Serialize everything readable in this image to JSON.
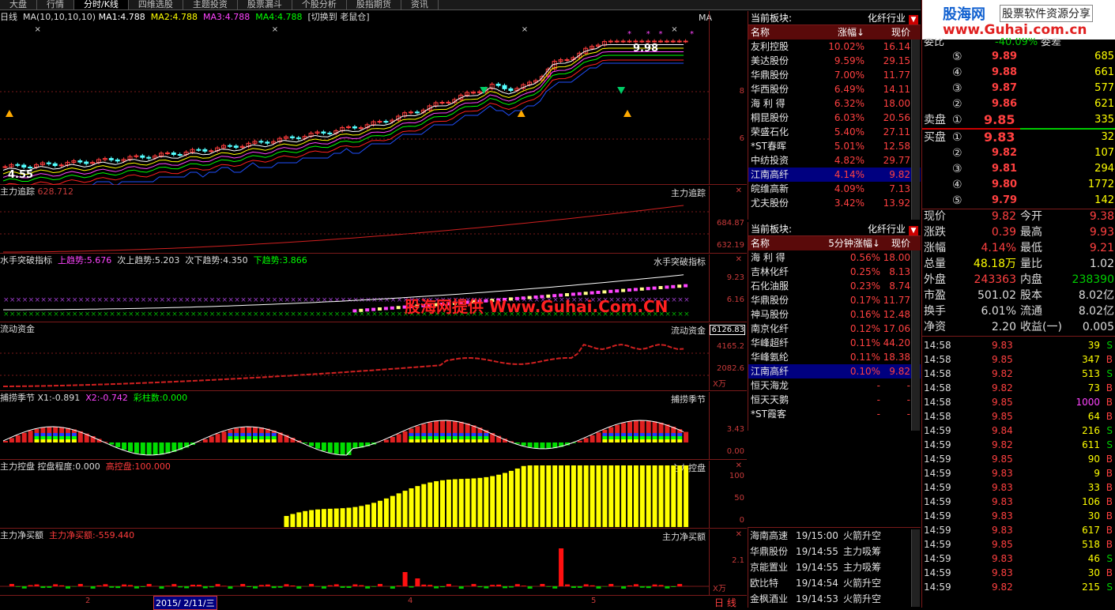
{
  "tabs": [
    "大盘",
    "行情",
    "分时/K线",
    "四维选股",
    "主题投资",
    "股票漏斗",
    "个股分析",
    "股指期货",
    "资讯"
  ],
  "main": {
    "title": "日线",
    "ma_label": "MA(10,10,10,10)",
    "ma1": "MA1:4.788",
    "ma2": "MA2:4.788",
    "ma3": "MA3:4.788",
    "ma4": "MA4:4.788",
    "switch": "[切换到 老鼠仓]",
    "corner": "MA",
    "high": "9.98",
    "low": "4.55",
    "y8": "8",
    "y6": "6"
  },
  "panels": {
    "p1": {
      "name": "主力追踪",
      "val": "628.712",
      "right": "主力追踪",
      "a1": "684.87",
      "a2": "632.19"
    },
    "p2": {
      "name": "水手突破指标",
      "up": "上趋势:5.676",
      "up2": "次上趋势:5.203",
      "dn2": "次下趋势:4.350",
      "dn": "下趋势:3.866",
      "right": "水手突破指标",
      "a1": "9.23",
      "a2": "6.16"
    },
    "p3": {
      "name": "流动资金",
      "right": "流动资金",
      "a0": "6126.83",
      "a1": "4165.2",
      "a2": "2082.6",
      "unit": "X万"
    },
    "p4": {
      "name": "捕捞季节",
      "x1": "X1:-0.891",
      "x2": "X2:-0.742",
      "cnt": "彩柱数:0.000",
      "right": "捕捞季节",
      "a1": "3.43",
      "a2": "0.00"
    },
    "p5": {
      "name": "主力控盘",
      "deg": "控盘程度:0.000",
      "high": "高控盘:100.000",
      "right": "主力控盘",
      "a1": "100",
      "a2": "50",
      "a3": "0"
    },
    "p6": {
      "name": "主力净买额",
      "val": "主力净买额:-559.440",
      "right": "主力净买额",
      "a1": "2.1",
      "unit": "X万"
    }
  },
  "xaxis": {
    "m2": "2",
    "date": "2015/ 2/11/三",
    "m4": "4",
    "m5": "5",
    "bar": "日 线"
  },
  "watermark": "股海网提供 Www.Guhai.Com.CN",
  "board1": {
    "label": "当前板块:",
    "sector": "化纤行业",
    "cols": [
      "名称",
      "涨幅↓",
      "现价"
    ],
    "rows": [
      [
        "友利控股",
        "10.02%",
        "16.14"
      ],
      [
        "美达股份",
        "9.59%",
        "29.15"
      ],
      [
        "华鼎股份",
        "7.00%",
        "11.77"
      ],
      [
        "华西股份",
        "6.49%",
        "14.11"
      ],
      [
        "海 利 得",
        "6.32%",
        "18.00"
      ],
      [
        "桐昆股份",
        "6.03%",
        "20.56"
      ],
      [
        "荣盛石化",
        "5.40%",
        "27.11"
      ],
      [
        "*ST春晖",
        "5.01%",
        "12.58"
      ],
      [
        "中纺投资",
        "4.82%",
        "29.77"
      ],
      [
        "江南高纤",
        "4.14%",
        "9.82"
      ],
      [
        "皖维高新",
        "4.09%",
        "7.13"
      ],
      [
        "尤夫股份",
        "3.42%",
        "13.92"
      ]
    ]
  },
  "board2": {
    "label": "当前板块:",
    "sector": "化纤行业",
    "cols": [
      "名称",
      "5分钟涨幅↓",
      "现价"
    ],
    "rows": [
      [
        "海 利 得",
        "0.56%",
        "18.00"
      ],
      [
        "吉林化纤",
        "0.25%",
        "8.13"
      ],
      [
        "石化油服",
        "0.23%",
        "8.74"
      ],
      [
        "华鼎股份",
        "0.17%",
        "11.77"
      ],
      [
        "神马股份",
        "0.16%",
        "12.48"
      ],
      [
        "南京化纤",
        "0.12%",
        "17.06"
      ],
      [
        "华峰超纤",
        "0.11%",
        "44.20"
      ],
      [
        "华峰氨纶",
        "0.11%",
        "18.38"
      ],
      [
        "江南高纤",
        "0.10%",
        "9.82"
      ],
      [
        "恒天海龙",
        "-",
        "-"
      ],
      [
        "恒天天鹅",
        "-",
        "-"
      ],
      [
        "*ST霞客",
        "-",
        "-"
      ]
    ]
  },
  "news": [
    [
      "海南高速",
      "19/15:00",
      "火箭升空"
    ],
    [
      "华鼎股份",
      "19/14:55",
      "主力吸筹"
    ],
    [
      "京能置业",
      "19/14:55",
      "主力吸筹"
    ],
    [
      "欧比特",
      "19/14:54",
      "火箭升空"
    ],
    [
      "金枫酒业",
      "19/14:53",
      "火箭升空"
    ]
  ],
  "logo": {
    "l1": "股海网",
    "l2": "股票软件资源分享",
    "l3": "www.Guhai.com.cn",
    "w": "委比",
    "v": "-40.09%",
    "diff": "委差"
  },
  "sell": [
    [
      "⑤",
      "9.89",
      "685"
    ],
    [
      "④",
      "9.88",
      "661"
    ],
    [
      "③",
      "9.87",
      "577"
    ],
    [
      "②",
      "9.86",
      "621"
    ],
    [
      "①",
      "9.85",
      "335"
    ]
  ],
  "buy": [
    [
      "①",
      "9.83",
      "32"
    ],
    [
      "②",
      "9.82",
      "107"
    ],
    [
      "③",
      "9.81",
      "294"
    ],
    [
      "④",
      "9.80",
      "1772"
    ],
    [
      "⑤",
      "9.79",
      "142"
    ]
  ],
  "sell_label": "卖盘",
  "buy_label": "买盘",
  "stats": [
    [
      "现价",
      "9.82",
      "今开",
      "9.38"
    ],
    [
      "涨跌",
      "0.39",
      "最高",
      "9.93"
    ],
    [
      "涨幅",
      "4.14%",
      "最低",
      "9.21"
    ],
    [
      "总量",
      "48.18万",
      "量比",
      "1.02"
    ],
    [
      "外盘",
      "243363",
      "内盘",
      "238390"
    ],
    [
      "市盈",
      "501.02",
      "股本",
      "8.02亿"
    ],
    [
      "换手",
      "6.01%",
      "流通",
      "8.02亿"
    ],
    [
      "净资",
      "2.20",
      "收益(一)",
      "0.005"
    ]
  ],
  "ticks": [
    [
      "14:58",
      "9.83",
      "39",
      "S"
    ],
    [
      "14:58",
      "9.85",
      "347",
      "B"
    ],
    [
      "14:58",
      "9.82",
      "513",
      "S"
    ],
    [
      "14:58",
      "9.82",
      "73",
      "B"
    ],
    [
      "14:58",
      "9.85",
      "1000",
      "B"
    ],
    [
      "14:58",
      "9.85",
      "64",
      "B"
    ],
    [
      "14:59",
      "9.84",
      "216",
      "S"
    ],
    [
      "14:59",
      "9.82",
      "611",
      "S"
    ],
    [
      "14:59",
      "9.85",
      "90",
      "B"
    ],
    [
      "14:59",
      "9.83",
      "9",
      "B"
    ],
    [
      "14:59",
      "9.83",
      "33",
      "B"
    ],
    [
      "14:59",
      "9.83",
      "106",
      "B"
    ],
    [
      "14:59",
      "9.83",
      "30",
      "B"
    ],
    [
      "14:59",
      "9.83",
      "617",
      "B"
    ],
    [
      "14:59",
      "9.85",
      "518",
      "B"
    ],
    [
      "14:59",
      "9.83",
      "46",
      "S"
    ],
    [
      "14:59",
      "9.83",
      "30",
      "B"
    ],
    [
      "14:59",
      "9.82",
      "215",
      "S"
    ]
  ],
  "colors": {
    "up": "#ff3c3c",
    "down": "#54ffff",
    "green": "#00cc00",
    "yellow": "#ffff00",
    "magenta": "#ff44ff",
    "bg": "#000000"
  }
}
